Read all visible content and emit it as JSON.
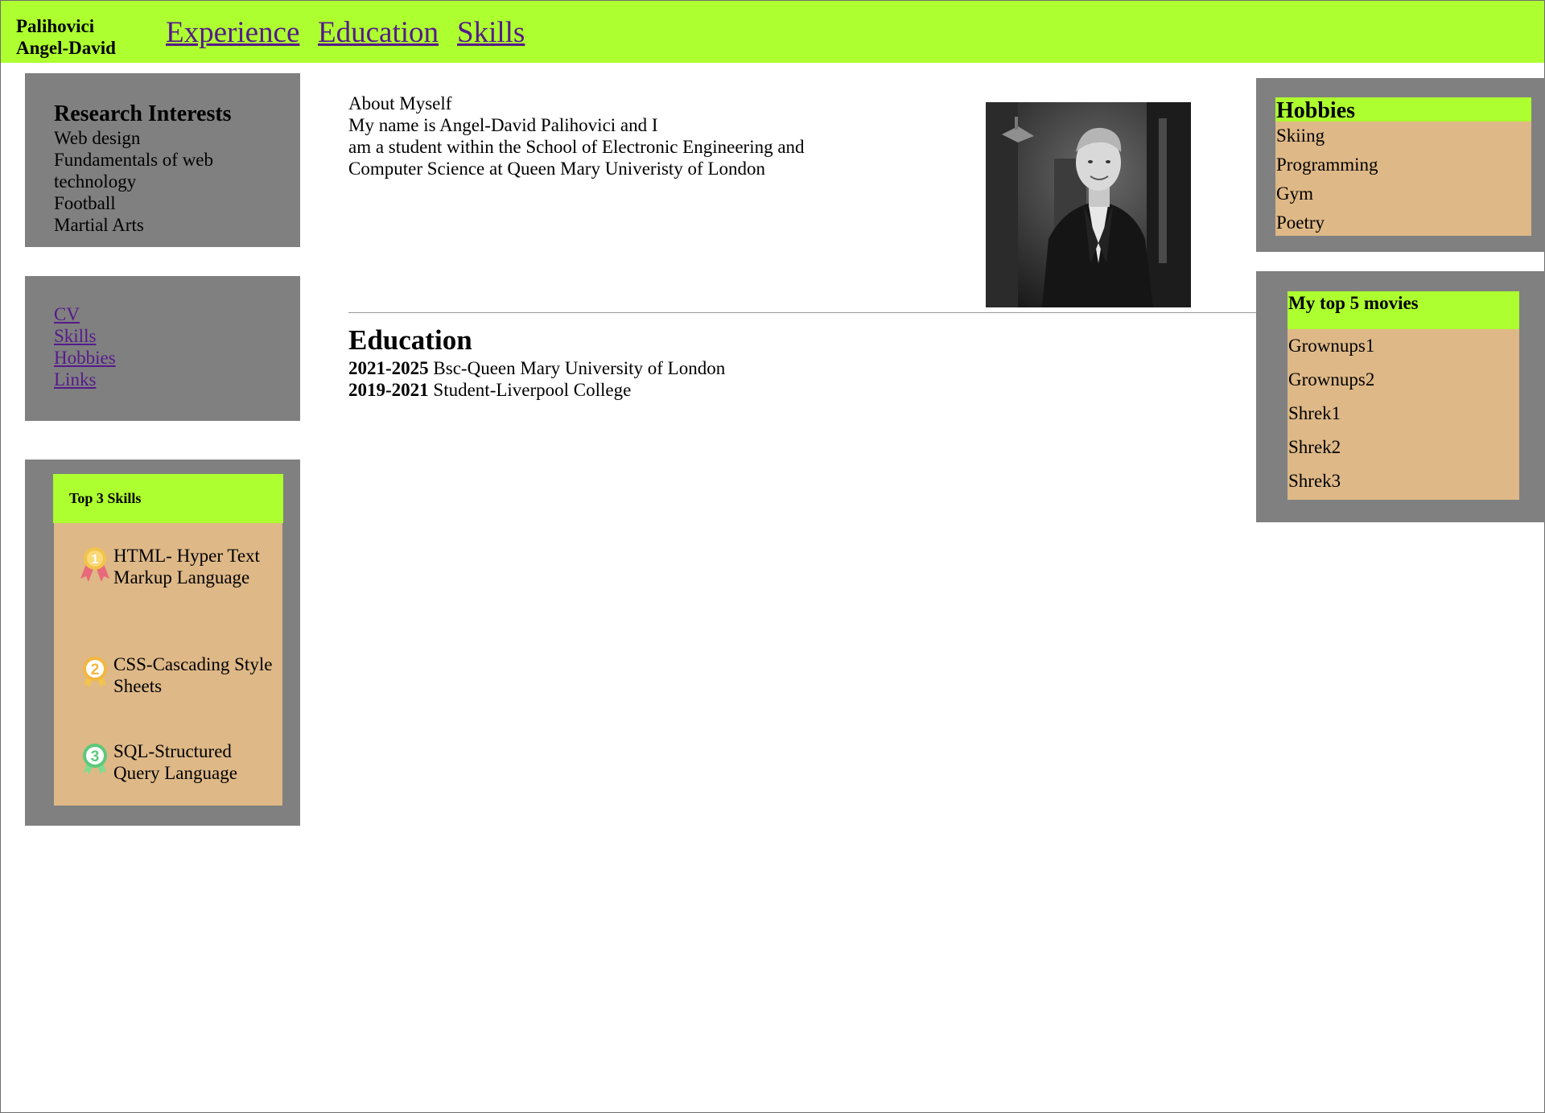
{
  "header": {
    "name_line1": "Palihovici",
    "name_line2": "Angel-David",
    "nav": [
      "Experience",
      "Education",
      "Skills"
    ]
  },
  "research": {
    "title": "Research Interests",
    "items": [
      "Web design",
      "Fundamentals of web technology",
      "Football",
      "Martial Arts"
    ]
  },
  "quick_links": [
    "CV",
    "Skills",
    "Hobbies",
    "Links"
  ],
  "top_skills": {
    "title": "Top 3 Skills",
    "items": [
      {
        "rank": "1",
        "text": "HTML- Hyper Text Markup Language",
        "icon": "gold-medal-icon"
      },
      {
        "rank": "2",
        "text": "CSS-Cascading Style Sheets",
        "icon": "silver-medal-icon"
      },
      {
        "rank": "3",
        "text": "SQL-Structured Query Language",
        "icon": "bronze-medal-icon"
      }
    ]
  },
  "about": {
    "title": "About Myself",
    "line1": "My name is Angel-David Palihovici and I",
    "line2": "am a student within the School of Electronic Engineering and",
    "line3": "Computer Science at Queen Mary Univeristy of London"
  },
  "education": {
    "title": "Education",
    "entries": [
      {
        "years": "2021-2025",
        "text": "Bsc-Queen Mary University of London"
      },
      {
        "years": "2019-2021",
        "text": "Student-Liverpool College"
      }
    ]
  },
  "hobbies": {
    "title": "Hobbies",
    "items": [
      "Skiing",
      "Programming",
      "Gym",
      "Poetry"
    ]
  },
  "movies": {
    "title": "My top 5 movies",
    "items": [
      "Grownups1",
      "Grownups2",
      "Shrek1",
      "Shrek2",
      "Shrek3"
    ]
  },
  "colors": {
    "accent_green": "#adff2f",
    "panel_gray": "#808080",
    "tan": "#deb887",
    "link_visited": "#551a8b"
  }
}
